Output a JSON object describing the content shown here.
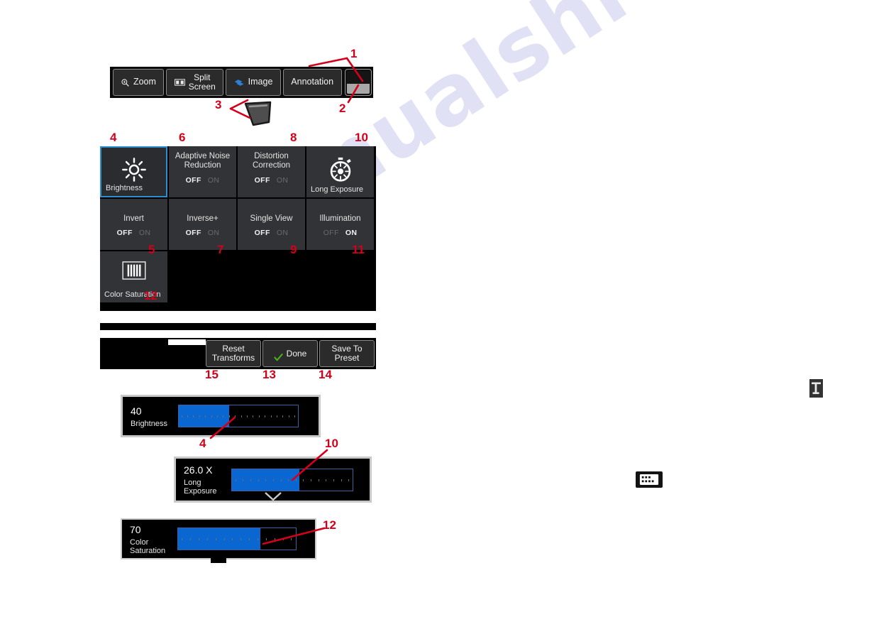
{
  "watermark": {
    "text": "manualshive.com"
  },
  "toolbar": {
    "buttons": [
      {
        "label": "Zoom",
        "icon": "magnifier-icon"
      },
      {
        "label": "Split\nScreen",
        "icon": "split-screen-icon"
      },
      {
        "label": "Image",
        "icon": "image-layers-icon"
      },
      {
        "label": "Annotation",
        "icon": "none"
      }
    ],
    "end_toggle": {
      "name": "screen-mode-toggle-button"
    }
  },
  "stylus": {
    "name": "stylus-pen-graphic"
  },
  "tiles": [
    {
      "title": "",
      "caption": "Brightness",
      "icon": "sun-icon",
      "selected": true,
      "toggle": null
    },
    {
      "title": "Adaptive Noise\nReduction",
      "caption": "",
      "icon": "none",
      "selected": false,
      "toggle": {
        "off": "OFF",
        "on": "ON",
        "state": "OFF"
      }
    },
    {
      "title": "Distortion\nCorrection",
      "caption": "",
      "icon": "none",
      "selected": false,
      "toggle": {
        "off": "OFF",
        "on": "ON",
        "state": "OFF"
      }
    },
    {
      "title": "",
      "caption": "Long Exposure",
      "icon": "stopwatch-icon",
      "selected": false,
      "toggle": null
    },
    {
      "title": "Invert",
      "caption": "",
      "icon": "none",
      "selected": false,
      "toggle": {
        "off": "OFF",
        "on": "ON",
        "state": "OFF"
      }
    },
    {
      "title": "Inverse+",
      "caption": "",
      "icon": "none",
      "selected": false,
      "toggle": {
        "off": "OFF",
        "on": "ON",
        "state": "OFF"
      }
    },
    {
      "title": "Single View",
      "caption": "",
      "icon": "none",
      "selected": false,
      "toggle": {
        "off": "OFF",
        "on": "ON",
        "state": "OFF"
      }
    },
    {
      "title": "Illumination",
      "caption": "",
      "icon": "none",
      "selected": false,
      "toggle": {
        "off": "OFF",
        "on": "ON",
        "state": "ON"
      }
    },
    {
      "title": "",
      "caption": "Color Saturation",
      "icon": "color-bars-icon",
      "selected": false,
      "toggle": null
    }
  ],
  "actions": [
    {
      "label": "Reset\nTransforms",
      "icon": "none"
    },
    {
      "label": "Done",
      "icon": "check-icon"
    },
    {
      "label": "Save To\nPreset",
      "icon": "none"
    }
  ],
  "sliders": [
    {
      "value": "40",
      "name": "Brightness",
      "fill_percent": 42
    },
    {
      "value": "26.0  X",
      "name": "Long\nExposure",
      "fill_percent": 56
    },
    {
      "value": "70",
      "name": "Color\nSaturation",
      "fill_percent": 70
    }
  ],
  "callouts": [
    {
      "n": "1"
    },
    {
      "n": "2"
    },
    {
      "n": "3"
    },
    {
      "n": "4"
    },
    {
      "n": "6"
    },
    {
      "n": "8"
    },
    {
      "n": "10"
    },
    {
      "n": "5"
    },
    {
      "n": "7"
    },
    {
      "n": "9"
    },
    {
      "n": "11"
    },
    {
      "n": "12"
    },
    {
      "n": "15"
    },
    {
      "n": "13"
    },
    {
      "n": "14"
    },
    {
      "n": "4"
    },
    {
      "n": "10"
    },
    {
      "n": "12"
    }
  ],
  "colors": {
    "accent_blue": "#0a66d0",
    "selection_blue": "#2a8fd0",
    "callout_red": "#d4001a",
    "check_green": "#4caf1d",
    "tile_bg": "#323336",
    "watermark": "#c9c9ee"
  }
}
